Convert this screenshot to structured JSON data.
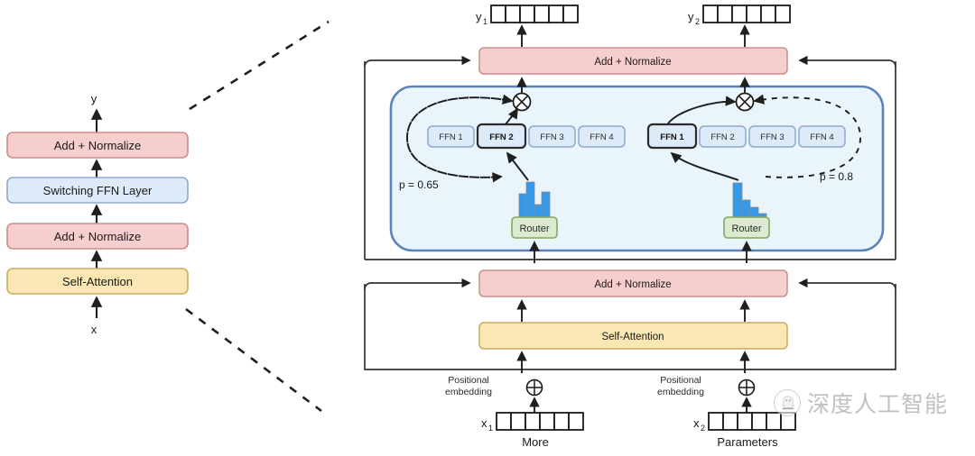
{
  "figure": {
    "type": "diagram",
    "subject": "Switch Transformer encoder block with Switching FFN (Mixture-of-Experts) layer",
    "panels": [
      "standard-transformer-block",
      "expanded-switching-ffn-layer"
    ]
  },
  "left_panel": {
    "output_label": "y",
    "input_label": "x",
    "blocks": [
      {
        "label": "Add + Normalize",
        "style": "pink"
      },
      {
        "label": "Switching FFN Layer",
        "style": "blue"
      },
      {
        "label": "Add + Normalize",
        "style": "pink"
      },
      {
        "label": "Self-Attention",
        "style": "yellow"
      }
    ]
  },
  "right_panel": {
    "top_addnorm_label": "Add + Normalize",
    "bottom_addnorm_label": "Add + Normalize",
    "self_attention_label": "Self-Attention",
    "outputs": [
      {
        "var": "y",
        "sub": "1",
        "cells": 6
      },
      {
        "var": "y",
        "sub": "2",
        "cells": 6
      }
    ],
    "inputs": [
      {
        "var": "x",
        "sub": "1",
        "cells": 6,
        "word": "More",
        "positional_label_line1": "Positional",
        "positional_label_line2": "embedding"
      },
      {
        "var": "x",
        "sub": "2",
        "cells": 6,
        "word": "Parameters",
        "positional_label_line1": "Positional",
        "positional_label_line2": "embedding"
      }
    ],
    "experts": [
      {
        "token": "x1",
        "router_label": "Router",
        "probability_label": "p = 0.65",
        "probability_value": 0.65,
        "selected_expert": "FFN 2",
        "ffn_labels": [
          "FFN 1",
          "FFN 2",
          "FFN 3",
          "FFN 4"
        ],
        "router_histogram": [
          0.55,
          1.0,
          0.33,
          0.6
        ]
      },
      {
        "token": "x2",
        "router_label": "Router",
        "probability_label": "p = 0.8",
        "probability_value": 0.8,
        "selected_expert": "FFN 1",
        "ffn_labels": [
          "FFN 1",
          "FFN 2",
          "FFN 3",
          "FFN 4"
        ],
        "router_histogram": [
          1.0,
          0.5,
          0.28,
          0.1
        ]
      }
    ]
  },
  "watermark": {
    "text": "深度人工智能",
    "logo_name": "wechat-mascot-logo"
  },
  "colors": {
    "pink_fill": "#f6cecd",
    "pink_border": "#c98d8a",
    "blue_fill": "#ddeaf7",
    "blue_border": "#8fa9cc",
    "yellow_fill": "#fbe7b3",
    "yellow_border": "#cbab5e",
    "green_fill": "#dcead1",
    "green_border": "#83a860",
    "switch_panel_fill": "#eaf4fb",
    "switch_panel_border": "#5b83b8",
    "bar_blue": "#3399e8",
    "line_black": "#262626"
  }
}
